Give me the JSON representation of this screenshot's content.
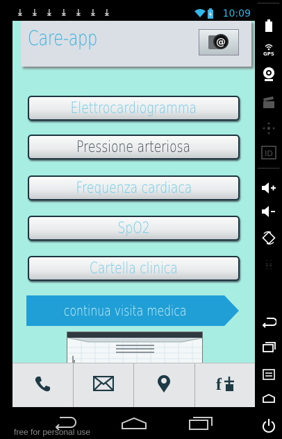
{
  "status_bar": {
    "time": "10:09"
  },
  "header": {
    "title": "Care-app"
  },
  "menu": [
    {
      "label": "Elettrocardiogramma",
      "color": "#6ccbe8"
    },
    {
      "label": "Pressione arteriosa",
      "color": "#3f4a50"
    },
    {
      "label": "Frequenza cardiaca",
      "color": "#6ccbe8"
    },
    {
      "label": "SpO2",
      "color": "#6ccbe8"
    },
    {
      "label": "Cartella clinica",
      "color": "#6ccbe8"
    }
  ],
  "continue_button": {
    "label": "continua visita medica",
    "color": "#1f9fd6"
  },
  "bottom_tabs": [
    {
      "icon": "phone-icon"
    },
    {
      "icon": "mail-icon"
    },
    {
      "icon": "location-pin-icon"
    },
    {
      "icon": "facebook-share-icon"
    }
  ],
  "watermark": "free for personal use",
  "emulator_sidebar": [
    "battery-icon",
    "gps-icon",
    "webcam-icon",
    "clapperboard-icon",
    "dpad-icon",
    "id-icon",
    "volume-up-icon",
    "volume-down-icon",
    "rotate-icon",
    "scale-icon",
    "back-icon",
    "recent-apps-icon",
    "menu-icon",
    "home-icon",
    "power-icon"
  ],
  "colors": {
    "screen_bg": "#a8ede2",
    "accent": "#33b5e5",
    "title": "#3bb0dc"
  }
}
